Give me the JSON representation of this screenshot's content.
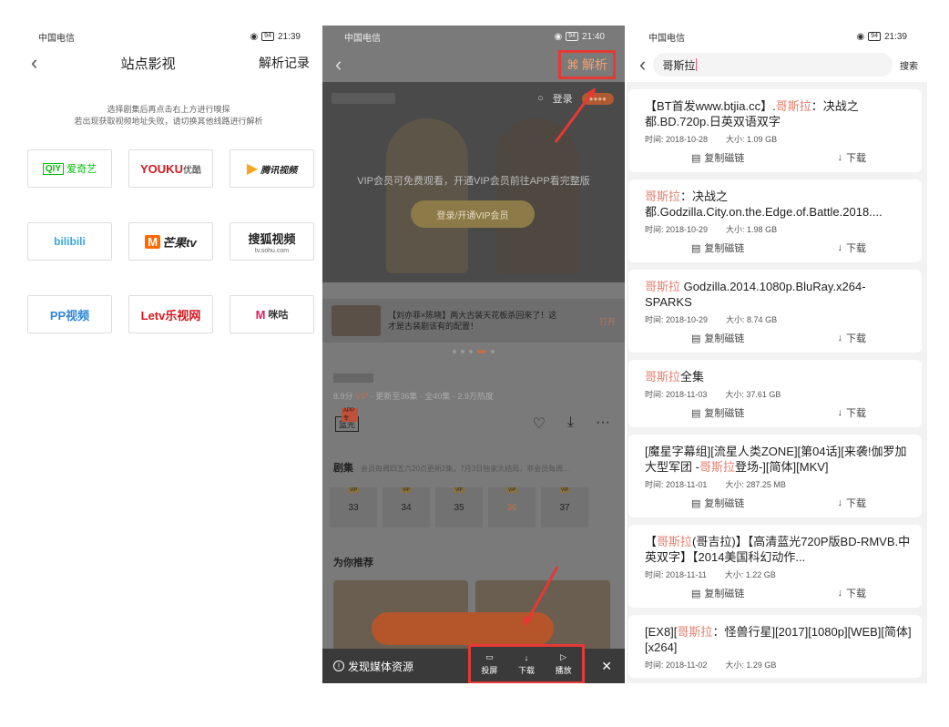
{
  "status": {
    "carrier": "中国电信",
    "battery": "94",
    "time_1": "21:39",
    "time_2": "21:40",
    "time_3": "21:39"
  },
  "panel1": {
    "title": "站点影视",
    "record": "解析记录",
    "hint_1": "选择剧集后再点击右上方进行嗅探",
    "hint_2": "若出现获取视频地址失败，请切换其他线路进行解析",
    "sites": [
      {
        "label": "爱奇艺",
        "logo": "QIY",
        "color": "#00be06"
      },
      {
        "label": "优酷",
        "logo": "YOUKU",
        "color": "#d6181f"
      },
      {
        "label": "腾讯视频",
        "logo": "▶",
        "color": "#222222"
      },
      {
        "label": "bilibili",
        "logo": "",
        "color": "#3aa7e1"
      },
      {
        "label": "芒果tv",
        "logo": "M",
        "color": "#ff6a00"
      },
      {
        "label": "搜狐视频",
        "logo": "tv.sohu.com",
        "color": "#e02020"
      },
      {
        "label": "PP视频",
        "logo": "",
        "color": "#2e86d6"
      },
      {
        "label": "Letv乐视网",
        "logo": "",
        "color": "#d6181f"
      },
      {
        "label": "咪咕",
        "logo": "M",
        "color": "#e02060"
      }
    ]
  },
  "panel2": {
    "parse": "解析",
    "login": "登录",
    "vip_text": "VIP会员可免费观看，开通VIP会员前往APP看完整版",
    "vip_btn": "登录/开通VIP会员",
    "promo": "【刘亦菲×陈晓】两大古装天花板杀回来了！这才是古装剧该有的配置！",
    "open": "打开",
    "meta_score": "8.9分",
    "meta_vip": "VIP",
    "meta_rest": "· 更新至36集 · 全40集 · 2.9万热度",
    "blu": "蓝光",
    "app_tag": "APP专",
    "episodes_label": "剧集",
    "episodes_sub": "会员每周四五六20点更新2集，7月3日独家大结局，非会员每周...",
    "episodes": [
      "33",
      "34",
      "35",
      "36",
      "37"
    ],
    "current_episode": "36",
    "ep_tag": "VIP",
    "recommend": "为你推荐",
    "found": "发现媒体资源",
    "cast": "投屏",
    "download": "下载",
    "play": "播放"
  },
  "panel3": {
    "query": "哥斯拉",
    "search": "搜索",
    "copy": "复制磁链",
    "dl": "下载",
    "results": [
      {
        "pre": "【BT首发www.btjia.cc】.",
        "hl": "哥斯拉",
        "post": "：决战之都.BD.720p.日英双语双字",
        "time": "时间: 2018-10-28",
        "size": "大小: 1.09 GB"
      },
      {
        "pre": "",
        "hl": "哥斯拉",
        "post": "：决战之都.Godzilla.City.on.the.Edge.of.Battle.2018....",
        "time": "时间: 2018-10-29",
        "size": "大小: 1.98 GB"
      },
      {
        "pre": "",
        "hl": "哥斯拉",
        "post": " Godzilla.2014.1080p.BluRay.x264-SPARKS",
        "time": "时间: 2018-10-29",
        "size": "大小: 8.74 GB"
      },
      {
        "pre": "",
        "hl": "哥斯拉",
        "post": "全集",
        "time": "时间: 2018-11-03",
        "size": "大小: 37.61 GB"
      },
      {
        "pre": "[魔星字幕组][流星人类ZONE][第04话][来袭!伽罗加大型军团 -",
        "hl": "哥斯拉",
        "post": "登场-][简体][MKV]",
        "time": "时间: 2018-11-01",
        "size": "大小: 287.25 MB"
      },
      {
        "pre": "【",
        "hl": "哥斯拉",
        "post": "(哥吉拉)】【高清蓝光720P版BD-RMVB.中英双字】【2014美国科幻动作...",
        "time": "时间: 2018-11-11",
        "size": "大小: 1.22 GB"
      },
      {
        "pre": "[EX8][",
        "hl": "哥斯拉",
        "post": "：怪兽行星][2017][1080p][WEB][简体][x264]",
        "time": "时间: 2018-11-02",
        "size": "大小: 1.29 GB"
      }
    ]
  }
}
